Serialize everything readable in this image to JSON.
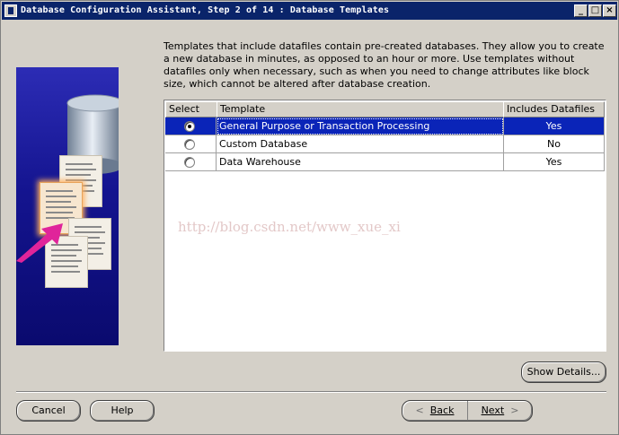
{
  "window": {
    "title": "Database Configuration Assistant, Step 2 of 14 : Database Templates",
    "controls": {
      "minimize": "_",
      "maximize": "□",
      "close": "×"
    }
  },
  "description": "Templates that include datafiles contain pre-created databases. They allow you to create a new database in minutes, as opposed to an hour or more. Use templates without datafiles only when necessary, such as when you need to change attributes like block size, which cannot be altered after database creation.",
  "table": {
    "headers": {
      "select": "Select",
      "template": "Template",
      "includes": "Includes Datafiles"
    },
    "rows": [
      {
        "template": "General Purpose or Transaction Processing",
        "includes": "Yes",
        "selected": true
      },
      {
        "template": "Custom Database",
        "includes": "No",
        "selected": false
      },
      {
        "template": "Data Warehouse",
        "includes": "Yes",
        "selected": false
      }
    ]
  },
  "watermark": "http://blog.csdn.net/www_xue_xi",
  "buttons": {
    "show_details": "Show Details...",
    "cancel": "Cancel",
    "help": "Help",
    "back": "Back",
    "next": "Next"
  },
  "colors": {
    "titlebar": "#0a246a",
    "selection": "#0a24b8",
    "window_bg": "#d4d0c8"
  },
  "icons": {
    "app": "app-icon",
    "back": "chevron-left-icon",
    "next": "chevron-right-icon"
  }
}
